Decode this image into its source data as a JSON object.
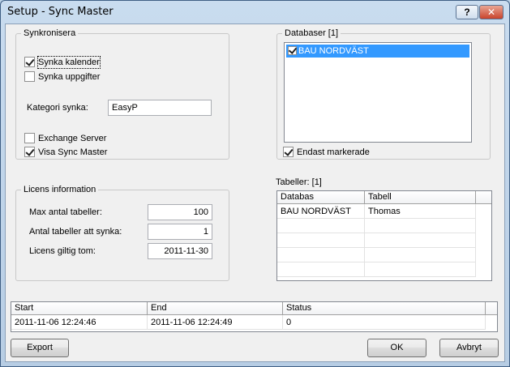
{
  "window": {
    "title": "Setup - Sync Master",
    "help_label": "?",
    "close_label": "✕"
  },
  "sync": {
    "legend": "Synkronisera",
    "sync_calendar": {
      "label": "Synka kalender",
      "checked": true
    },
    "sync_tasks": {
      "label": "Synka uppgifter",
      "checked": false
    },
    "category_label": "Kategori synka:",
    "category_value": "EasyP",
    "exchange_server": {
      "label": "Exchange Server",
      "checked": false
    },
    "show_sync_master": {
      "label": "Visa Sync Master",
      "checked": true
    }
  },
  "databases": {
    "legend": "Databaser [1]",
    "items": [
      {
        "label": "BAU NORDVÄST",
        "checked": true
      }
    ],
    "only_selected": {
      "label": "Endast markerade",
      "checked": true
    }
  },
  "license": {
    "legend": "Licens information",
    "max_tables_label": "Max antal tabeller:",
    "max_tables_value": "100",
    "tables_to_sync_label": "Antal tabeller att synka:",
    "tables_to_sync_value": "1",
    "valid_until_label": "Licens giltig tom:",
    "valid_until_value": "2011-11-30"
  },
  "tables": {
    "label": "Tabeller: [1]",
    "columns": [
      "Databas",
      "Tabell"
    ],
    "rows": [
      [
        "BAU NORDVÄST",
        "Thomas"
      ]
    ]
  },
  "log": {
    "columns": [
      "Start",
      "End",
      "Status"
    ],
    "rows": [
      [
        "2011-11-06 12:24:46",
        "2011-11-06 12:24:49",
        "0"
      ]
    ]
  },
  "buttons": {
    "export": "Export",
    "ok": "OK",
    "cancel": "Avbryt"
  }
}
